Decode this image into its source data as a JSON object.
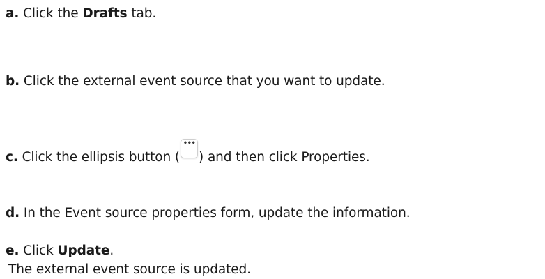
{
  "steps": {
    "a": {
      "letter": "a.",
      "pre": " Click the ",
      "bold": "Drafts",
      "post": " tab."
    },
    "b": {
      "letter": "b.",
      "text": " Click the external event source that you want to update."
    },
    "c": {
      "letter": "c.",
      "pre": " Click the ellipsis button (",
      "icon_name": "ellipsis-icon",
      "post": ") and then click Properties."
    },
    "d": {
      "letter": "d.",
      "text": " In the Event source properties form, update the information."
    },
    "e": {
      "letter": "e.",
      "pre": " Click ",
      "bold": "Update",
      "post": ".",
      "result": "The external event source is updated."
    }
  }
}
